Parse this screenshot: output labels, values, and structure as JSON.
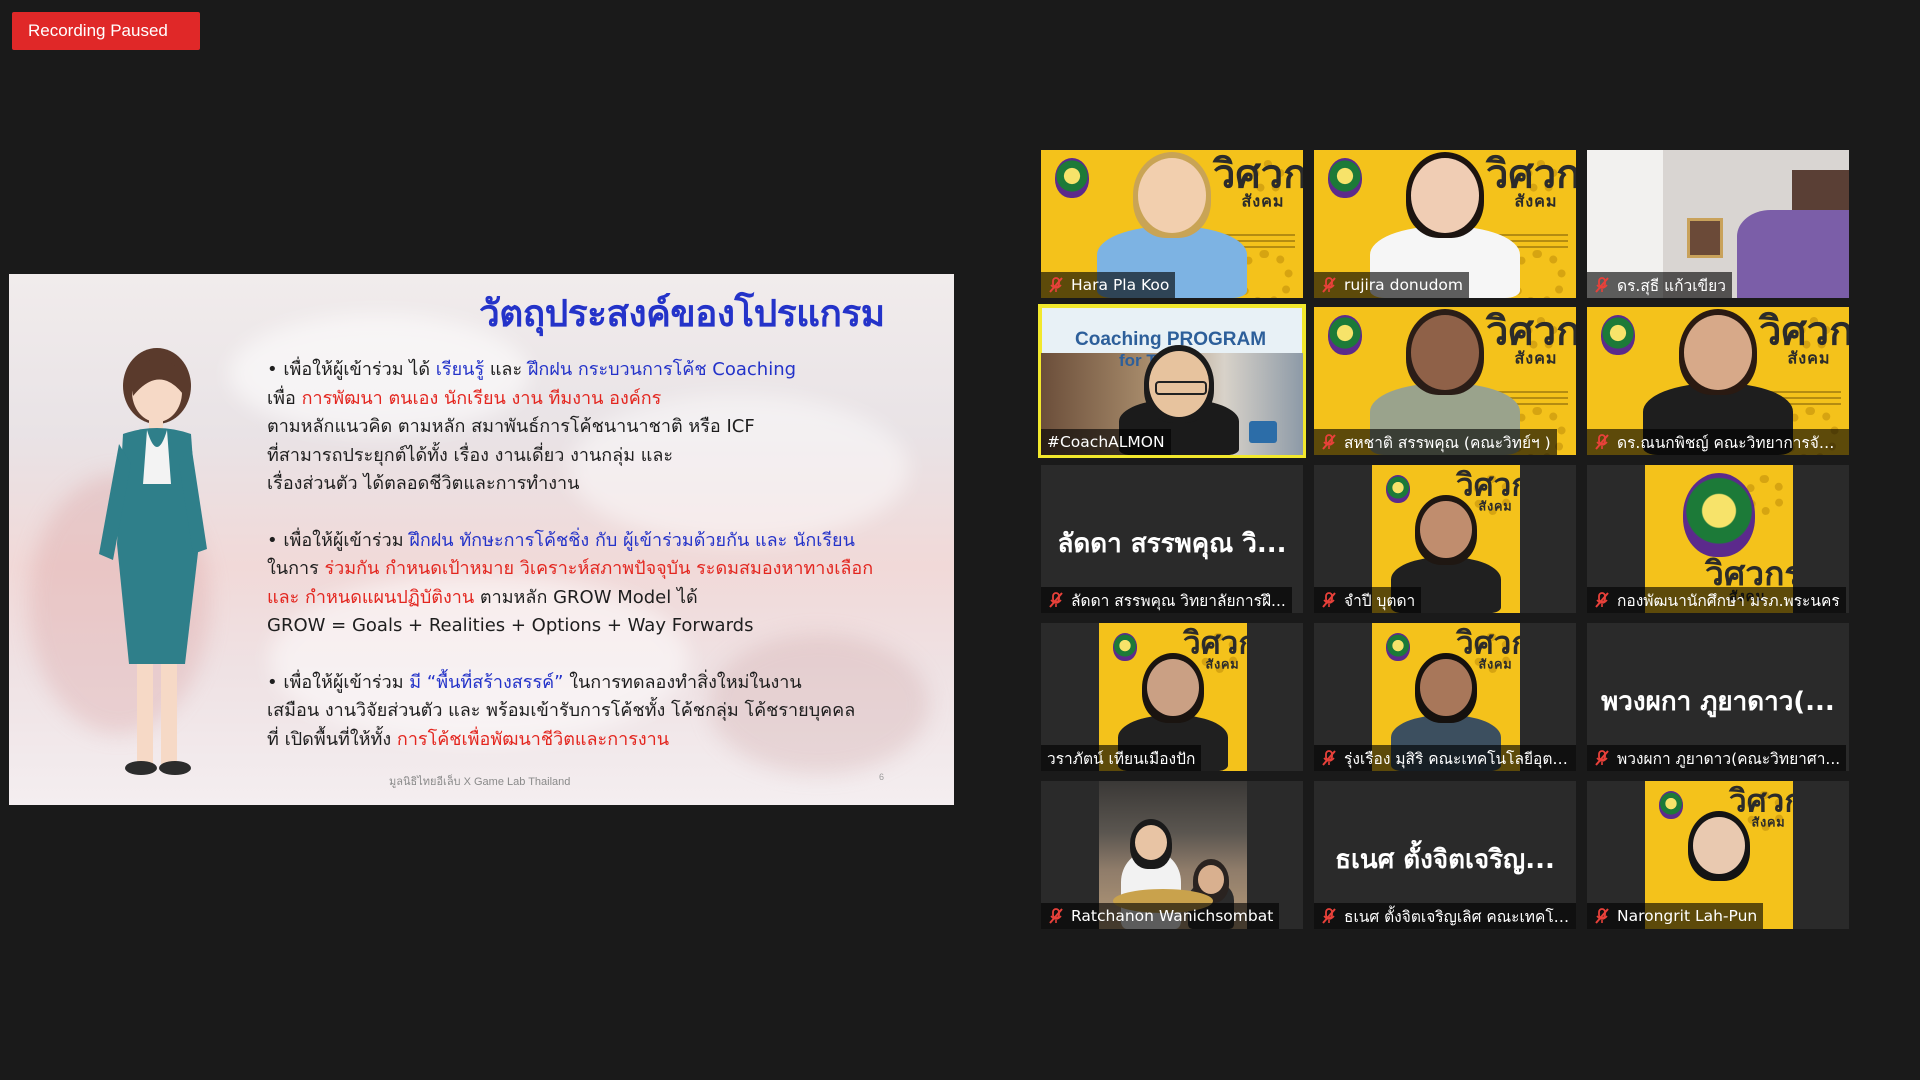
{
  "recording": {
    "status": "Recording Paused"
  },
  "slide": {
    "title": "วัตถุประสงค์ของโปรแกรม",
    "bullet1": {
      "prefix": "• เพื่อให้ผู้เข้าร่วม ได้ ",
      "hl1": "เรียนรู้",
      "mid1": " และ ",
      "hl2": "ฝึกฝน กระบวนการโค้ช Coaching",
      "line2_prefix": "เพื่อ ",
      "line2_hl": "การพัฒนา ตนเอง นักเรียน งาน ทีมงาน องค์กร",
      "line3": "ตามหลักแนวคิด ตามหลัก สมาพันธ์การโค้ชนานาชาติ หรือ ICF",
      "line4": "ที่สามารถประยุกต์ได้ทั้ง เรื่อง งานเดี่ยว งานกลุ่ม และ",
      "line5": "เรื่องส่วนตัว ได้ตลอดชีวิตและการทำงาน"
    },
    "bullet2": {
      "prefix": "• เพื่อให้ผู้เข้าร่วม ",
      "hl1": "ฝึกฝน ทักษะการโค้ชชิ่ง กับ ผู้เข้าร่วมด้วยกัน และ นักเรียน",
      "line2_prefix": "ในการ ",
      "line2_hl1": "ร่วมกัน",
      "line2_hl2": " กำหนดเป้าหมาย วิเคราะห์สภาพปัจจุบัน ระดมสมองหาทางเลือก",
      "line3_hl": "และ กำหนดแผนปฏิบัติงาน",
      "line3_rest": " ตามหลัก GROW Model ได้",
      "line4": "GROW = Goals + Realities + Options + Way Forwards"
    },
    "bullet3": {
      "prefix": "• เพื่อให้ผู้เข้าร่วม ",
      "hl1": "มี “พื้นที่สร้างสรรค์”",
      "rest1": " ในการทดลองทำสิ่งใหม่ในงาน",
      "line2": "เสมือน งานวิจัยส่วนตัว และ พร้อมเข้ารับการโค้ชทั้ง โค้ชกลุ่ม โค้ชรายบุคคล",
      "line3_prefix": "ที่ เปิดพื้นที่ให้ทั้ง ",
      "line3_hl": "การโค้ชเพื่อพัฒนาชีวิตและการงาน"
    },
    "footer": "มูลนิธิไทยอีเล็บ X Game Lab Thailand",
    "page_number": "6"
  },
  "branding": {
    "big": "วิศวกร",
    "small": "สังคม"
  },
  "coach_banner": {
    "line1": "Coaching PROGRAM",
    "line2": "for Trainer"
  },
  "participants": [
    {
      "name": "Hara Pla Koo",
      "muted": true
    },
    {
      "name": "rujira donudom",
      "muted": true
    },
    {
      "name": "ดร.สุธี  แก้วเขียว",
      "muted": true
    },
    {
      "name": "#CoachALMON",
      "muted": false,
      "active": true
    },
    {
      "name": "สหชาติ สรรพคุณ (คณะวิทย์ฯ )",
      "muted": true
    },
    {
      "name": "ดร.ณนกพิชญ์ คณะวิทยาการจัด...",
      "muted": true
    },
    {
      "name": "ลัดดา สรรพคุณ วิทยาลัยการฝึ...",
      "muted": true,
      "display": "ลัดดา สรรพคุณ วิ..."
    },
    {
      "name": "จำปี บุตดา",
      "muted": true
    },
    {
      "name": "กองพัฒนานักศึกษา มรภ.พระนคร",
      "muted": true
    },
    {
      "name": "วราภัตน์ เทียนเมืองปัก",
      "muted": false
    },
    {
      "name": "รุ่งเรือง มุสิริ คณะเทคโนโลยีอุตส...",
      "muted": true
    },
    {
      "name": "พวงผกา ภูยาดาว(คณะวิทยาศา...",
      "muted": true,
      "display": "พวงผกา ภูยาดาว(..."
    },
    {
      "name": "Ratchanon Wanichsombat",
      "muted": true
    },
    {
      "name": "ธเนศ ตั้งจิตเจริญเลิศ คณะเทคโน...",
      "muted": true,
      "display": "ธเนศ ตั้งจิตเจริญ..."
    },
    {
      "name": "Narongrit Lah-Pun",
      "muted": true
    }
  ],
  "colors": {
    "recording": "#e02828",
    "active_speaker": "#f2e82c",
    "slide_blue": "#2433c9",
    "slide_red": "#e3261f",
    "mute_red": "#e8413a"
  }
}
